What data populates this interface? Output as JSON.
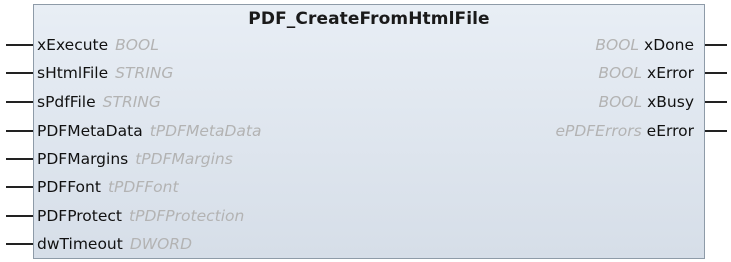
{
  "block": {
    "title": "PDF_CreateFromHtmlFile",
    "inputs": [
      {
        "name": "xExecute",
        "type": "BOOL"
      },
      {
        "name": "sHtmlFile",
        "type": "STRING"
      },
      {
        "name": "sPdfFile",
        "type": "STRING"
      },
      {
        "name": "PDFMetaData",
        "type": "tPDFMetaData"
      },
      {
        "name": "PDFMargins",
        "type": "tPDFMargins"
      },
      {
        "name": "PDFFont",
        "type": "tPDFFont"
      },
      {
        "name": "PDFProtect",
        "type": "tPDFProtection"
      },
      {
        "name": "dwTimeout",
        "type": "DWORD"
      }
    ],
    "outputs": [
      {
        "name": "xDone",
        "type": "BOOL"
      },
      {
        "name": "xError",
        "type": "BOOL"
      },
      {
        "name": "xBusy",
        "type": "BOOL"
      },
      {
        "name": "eError",
        "type": "ePDFErrors"
      }
    ]
  }
}
